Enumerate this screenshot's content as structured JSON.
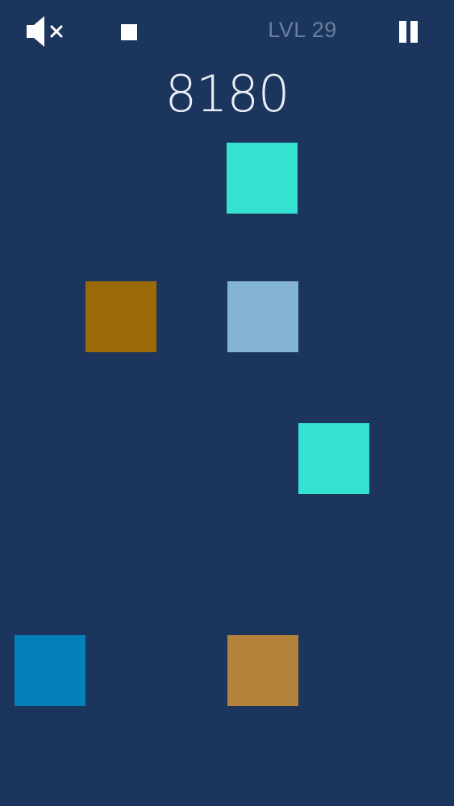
{
  "hud": {
    "mute_icon": "speaker-muted-icon",
    "stop_icon": "stop-square-icon",
    "pause_icon": "pause-icon",
    "level_text": "LVL 29",
    "score": "8180"
  },
  "colors": {
    "background": "#1c355d",
    "turquoise": "#35e2d1",
    "ochre": "#9a6a06",
    "light_blue": "#84b4d3",
    "blue": "#0380b7",
    "tan": "#b5823b"
  },
  "tiles": [
    {
      "color": "#35e2d1"
    },
    {
      "color": "#9a6a06"
    },
    {
      "color": "#84b4d3"
    },
    {
      "color": "#35e2d1"
    },
    {
      "color": "#0380b7"
    },
    {
      "color": "#b5823b"
    }
  ]
}
